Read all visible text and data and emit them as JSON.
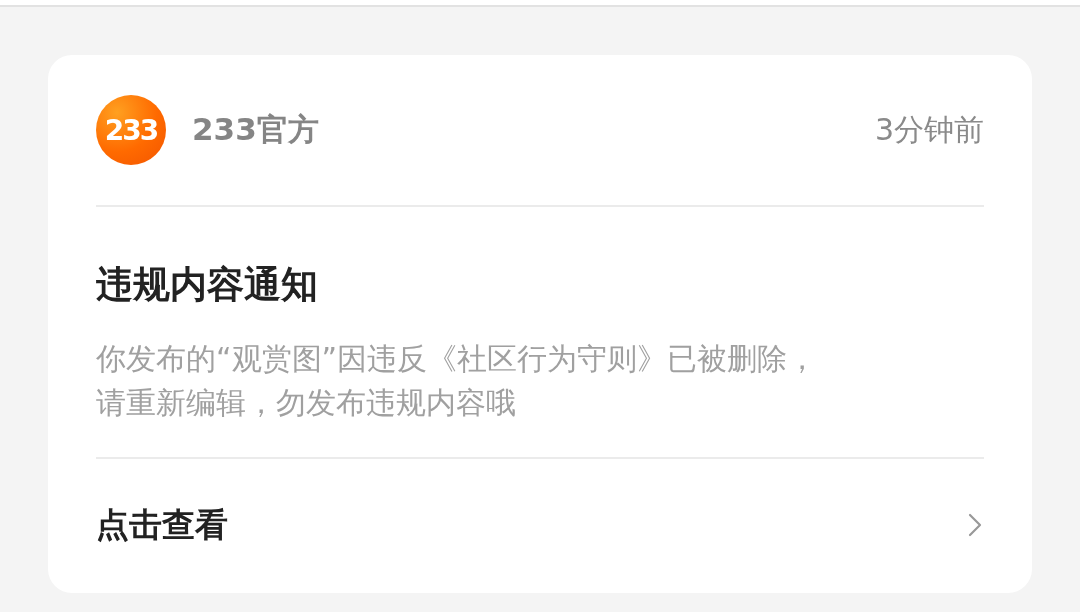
{
  "notification": {
    "sender": {
      "logo_text": "233",
      "name": "233官方"
    },
    "time": "3分钟前",
    "title": "违规内容通知",
    "message": "你发布的“观赏图”因违反《社区行为守则》已被删除，请重新编辑，勿发布违规内容哦",
    "action": "点击查看"
  }
}
